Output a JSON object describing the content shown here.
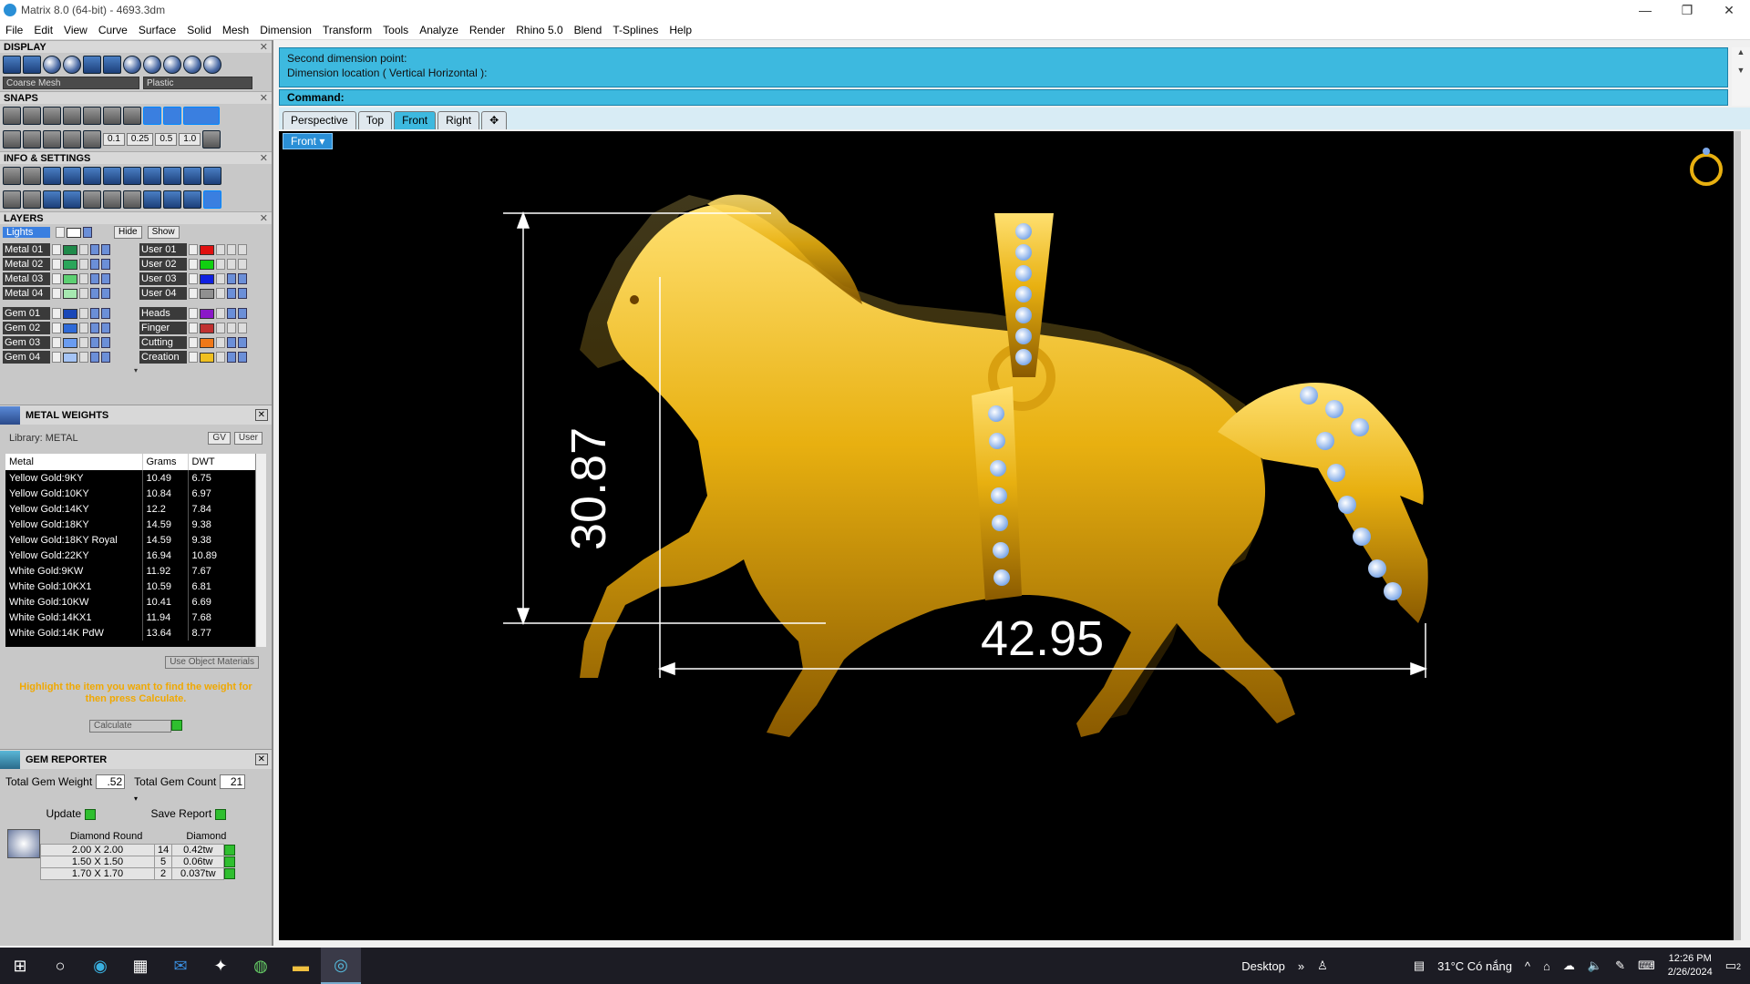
{
  "window": {
    "title": "Matrix 8.0 (64-bit) - 4693.3dm",
    "min": "—",
    "max": "❐",
    "close": "✕"
  },
  "menu": [
    "File",
    "Edit",
    "View",
    "Curve",
    "Surface",
    "Solid",
    "Mesh",
    "Dimension",
    "Transform",
    "Tools",
    "Analyze",
    "Render",
    "Rhino 5.0",
    "Blend",
    "T-Splines",
    "Help"
  ],
  "panels": {
    "display": {
      "title": "DISPLAY",
      "mesh_dropdown": "Coarse Mesh",
      "material_dropdown": "Plastic"
    },
    "snaps": {
      "title": "SNAPS",
      "values": [
        "0.1",
        "0.25",
        "0.5",
        "1.0"
      ]
    },
    "info": {
      "title": "INFO & SETTINGS"
    },
    "layers": {
      "title": "LAYERS",
      "lights_label": "Lights",
      "hide_label": "Hide",
      "show_label": "Show",
      "left": [
        {
          "name": "Metal 01",
          "color": "#1f8a4a"
        },
        {
          "name": "Metal 02",
          "color": "#2aa55a"
        },
        {
          "name": "Metal 03",
          "color": "#5cd072"
        },
        {
          "name": "Metal 04",
          "color": "#a6e8b0"
        },
        {
          "name": "Gem 01",
          "color": "#1a48b8"
        },
        {
          "name": "Gem 02",
          "color": "#2e6ad8"
        },
        {
          "name": "Gem 03",
          "color": "#6a9cf0"
        },
        {
          "name": "Gem 04",
          "color": "#a5c4f5"
        }
      ],
      "right": [
        {
          "name": "User 01",
          "color": "#e01010"
        },
        {
          "name": "User 02",
          "color": "#10d010"
        },
        {
          "name": "User 03",
          "color": "#1020e0"
        },
        {
          "name": "User 04",
          "color": "#909090"
        },
        {
          "name": "Heads",
          "color": "#8a18c8"
        },
        {
          "name": "Finger",
          "color": "#c03030"
        },
        {
          "name": "Cutting",
          "color": "#f07818"
        },
        {
          "name": "Creation",
          "color": "#f0c020"
        }
      ]
    },
    "metal_weights": {
      "title": "METAL WEIGHTS",
      "library": "Library: METAL",
      "gv": "GV",
      "user": "User",
      "headers": [
        "Metal",
        "Grams",
        "DWT"
      ],
      "rows": [
        [
          "Yellow Gold:9KY",
          "10.49",
          "6.75"
        ],
        [
          "Yellow Gold:10KY",
          "10.84",
          "6.97"
        ],
        [
          "Yellow Gold:14KY",
          "12.2",
          "7.84"
        ],
        [
          "Yellow Gold:18KY",
          "14.59",
          "9.38"
        ],
        [
          "Yellow Gold:18KY Royal",
          "14.59",
          "9.38"
        ],
        [
          "Yellow Gold:22KY",
          "16.94",
          "10.89"
        ],
        [
          "White Gold:9KW",
          "11.92",
          "7.67"
        ],
        [
          "White Gold:10KX1",
          "10.59",
          "6.81"
        ],
        [
          "White Gold:10KW",
          "10.41",
          "6.69"
        ],
        [
          "White Gold:14KX1",
          "11.94",
          "7.68"
        ],
        [
          "White Gold:14K PdW",
          "13.64",
          "8.77"
        ]
      ],
      "use_object_materials": "Use Object Materials",
      "hint": "Highlight the item you want to find the weight for then press Calculate.",
      "calculate": "Calculate"
    },
    "gem_reporter": {
      "title": "GEM REPORTER",
      "total_weight_label": "Total Gem Weight",
      "total_weight": ".52",
      "total_count_label": "Total Gem Count",
      "total_count": "21",
      "update": "Update",
      "save_report": "Save Report",
      "col1": "Diamond Round",
      "col2": "Diamond",
      "rows": [
        [
          "2.00 X 2.00",
          "14",
          "0.42tw"
        ],
        [
          "1.50 X 1.50",
          "5",
          "0.06tw"
        ],
        [
          "1.70 X 1.70",
          "2",
          "0.037tw"
        ]
      ]
    }
  },
  "command": {
    "history": [
      "Second dimension point:",
      "Dimension location ( Vertical  Horizontal ):"
    ],
    "prompt": "Command:"
  },
  "view_tabs": [
    "Perspective",
    "Top",
    "Front",
    "Right"
  ],
  "active_view": "Front",
  "viewport_label": "Front",
  "dimensions": {
    "vertical": "30.87",
    "horizontal": "42.95"
  },
  "taskbar": {
    "desktop_label": "Desktop",
    "weather": "31°C  Có nắng",
    "time": "12:26 PM",
    "date": "2/26/2024",
    "notifications": "2"
  },
  "colors": {
    "gold": "#e8b010",
    "cmd_blue": "#3db9df",
    "accent": "#2a8fd6"
  }
}
